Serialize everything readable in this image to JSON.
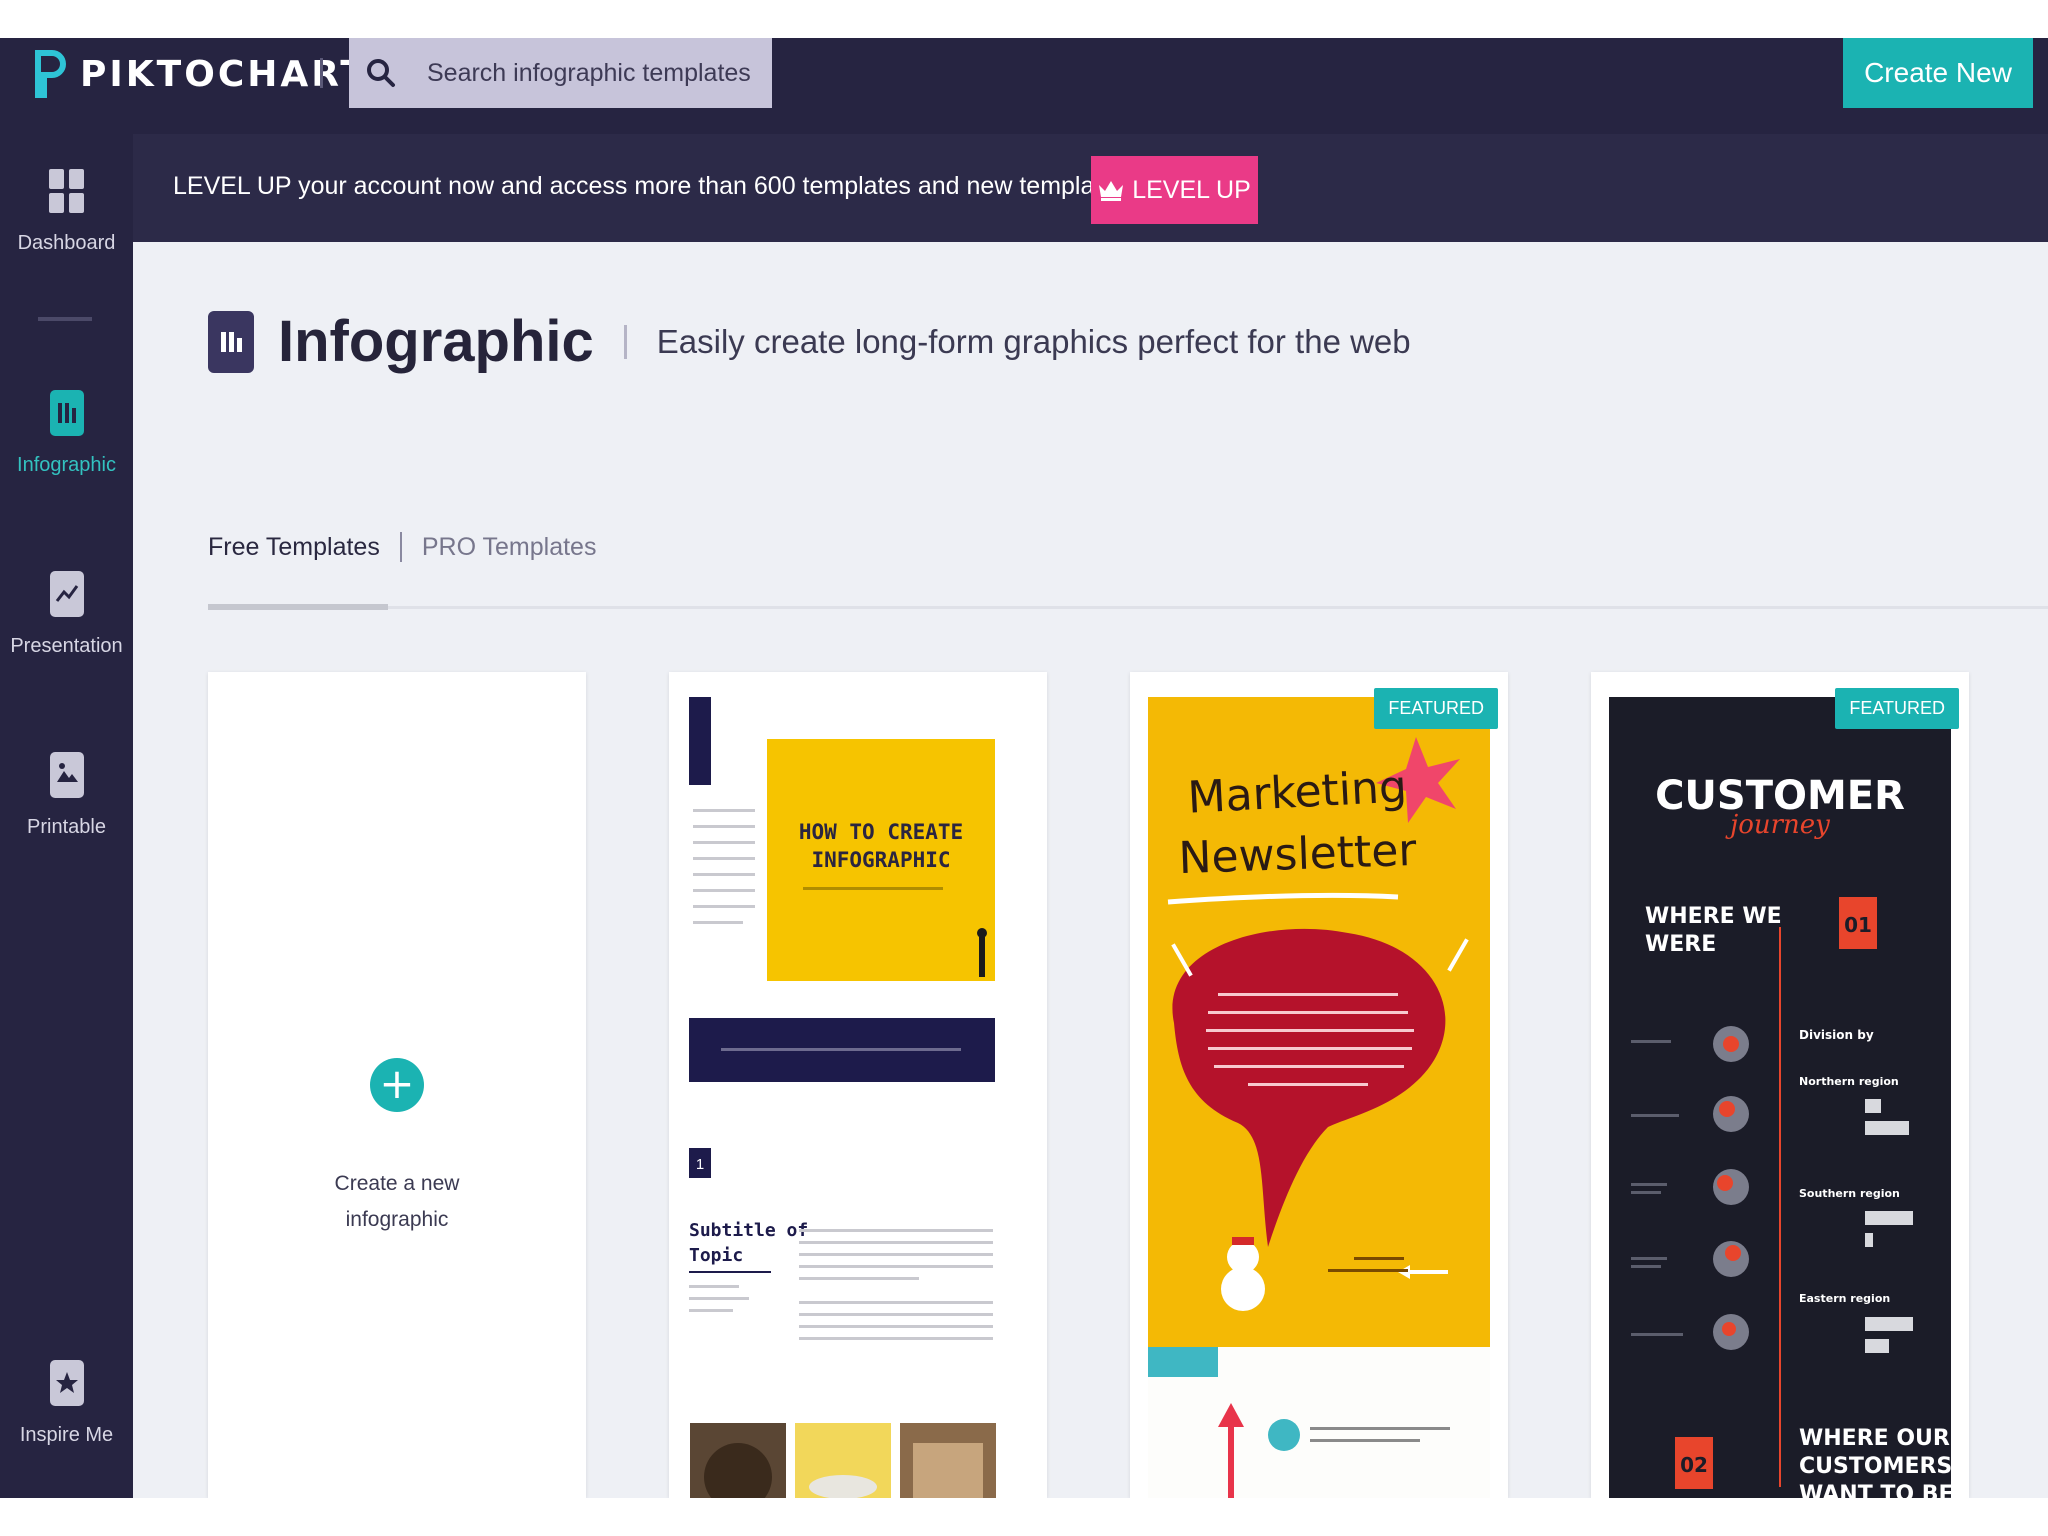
{
  "app": {
    "logo_text": "PIKTOCHART",
    "colors": {
      "nav_bg": "#262441",
      "accent": "#1bb3b2",
      "promo": "#ea3a87",
      "content_bg": "#eef0f5"
    }
  },
  "header": {
    "search_placeholder": "Search infographic templates",
    "create_new_label": "Create New"
  },
  "sidebar": {
    "items": [
      {
        "label": "Dashboard",
        "icon": "dashboard-grid-icon"
      },
      {
        "label": "Infographic",
        "icon": "infographic-icon",
        "active": true
      },
      {
        "label": "Presentation",
        "icon": "presentation-chart-icon"
      },
      {
        "label": "Printable",
        "icon": "printable-image-icon"
      },
      {
        "label": "Inspire Me",
        "icon": "star-icon"
      }
    ]
  },
  "banner": {
    "text": "LEVEL UP your account now and access more than 600 templates and new template every week.",
    "button_label": "LEVEL UP",
    "button_icon": "crown-icon"
  },
  "page": {
    "title": "Infographic",
    "subtitle": "Easily create long-form graphics perfect for the web"
  },
  "tabs": [
    {
      "label": "Free Templates",
      "active": true
    },
    {
      "label": "PRO Templates"
    }
  ],
  "cards": {
    "create_label_1": "Create a new",
    "create_label_2": "infographic",
    "template_1": {
      "heading_1": "HOW TO CREATE",
      "heading_2": "INFOGRAPHIC",
      "section_number": "1",
      "subtitle_1": "Subtitle of",
      "subtitle_2": "Topic"
    },
    "template_2": {
      "badge": "FEATURED",
      "title_1": "Marketing",
      "title_2": "Newsletter"
    },
    "template_3": {
      "badge": "FEATURED",
      "title": "CUSTOMER",
      "title_script": "journey",
      "section_1_1": "WHERE WE",
      "section_1_2": "WERE",
      "step_1": "01",
      "division_label": "Division by",
      "region_1": "Northern region",
      "region_2": "Southern region",
      "region_3": "Eastern region",
      "step_2": "02",
      "section_2_1": "WHERE OUR",
      "section_2_2": "CUSTOMERS",
      "section_2_3": "WANT TO BE"
    }
  }
}
